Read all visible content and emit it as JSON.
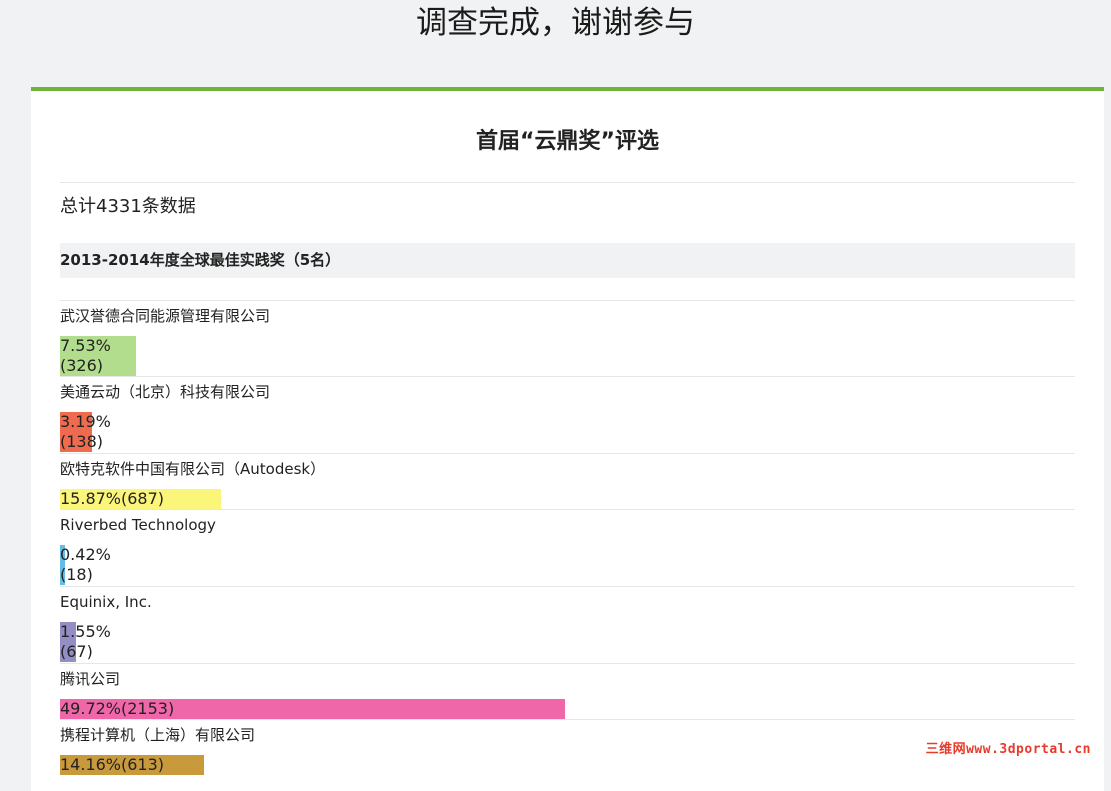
{
  "header": {
    "title": "调查完成，谢谢参与"
  },
  "survey": {
    "title": "首届“云鼎奖”评选",
    "total": "总计4331条数据",
    "question": "2013-2014年度全球最佳实践奖（5名）",
    "options": [
      {
        "label": "武汉誉德合同能源管理有限公司",
        "percent": "7.53%",
        "count": "(326)",
        "value": 7.53,
        "color": "#b1dd8c"
      },
      {
        "label": "美通云动（北京）科技有限公司",
        "percent": "3.19%",
        "count": "(138)",
        "value": 3.19,
        "color": "#ee6b4f"
      },
      {
        "label": "欧特克软件中国有限公司（Autodesk）",
        "percent": "15.87%",
        "count": "(687)",
        "value": 15.87,
        "color": "#fbf679"
      },
      {
        "label": "Riverbed Technology",
        "percent": "0.42%",
        "count": "(18)",
        "value": 0.42,
        "color": "#65bde6"
      },
      {
        "label": "Equinix, Inc.",
        "percent": "1.55%",
        "count": "(67)",
        "value": 1.55,
        "color": "#938fc4"
      },
      {
        "label": "腾讯公司",
        "percent": "49.72%",
        "count": "(2153)",
        "value": 49.72,
        "color": "#ef66a9"
      },
      {
        "label": "携程计算机（上海）有限公司",
        "percent": "14.16%",
        "count": "(613)",
        "value": 14.16,
        "color": "#c99a3c"
      }
    ]
  },
  "watermark": "三维网www.3dportal.cn"
}
